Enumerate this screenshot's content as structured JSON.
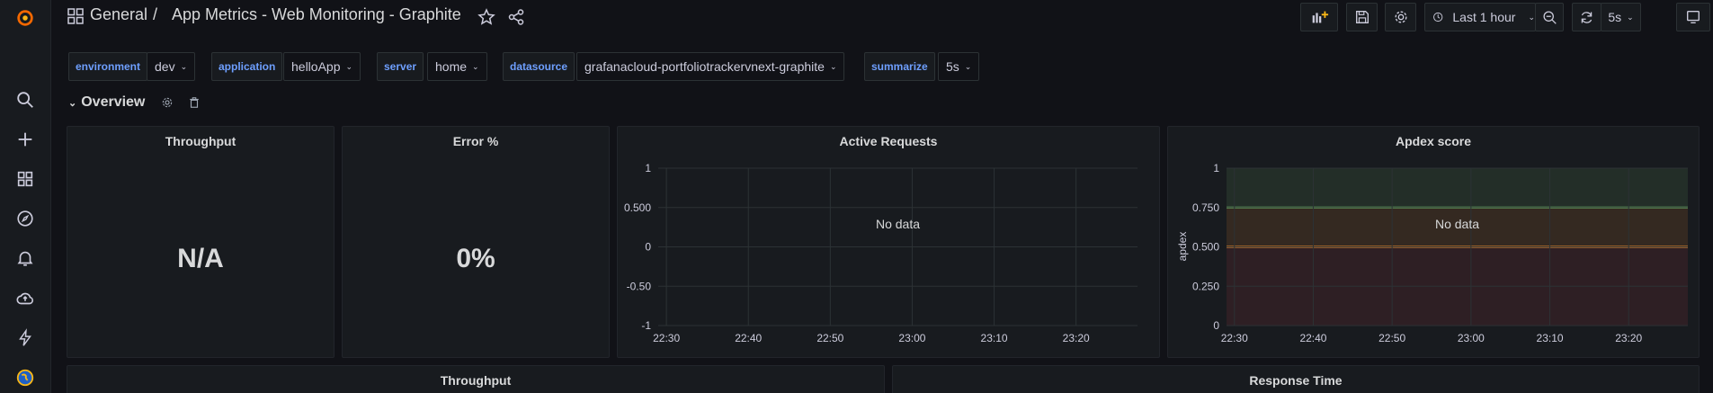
{
  "breadcrumb": {
    "folder": "General",
    "separator": "/",
    "title": "App Metrics - Web Monitoring - Graphite"
  },
  "toolbar": {
    "time_range": "Last 1 hour",
    "refresh": "5s"
  },
  "variables": [
    {
      "label": "environment",
      "value": "dev"
    },
    {
      "label": "application",
      "value": "helloApp"
    },
    {
      "label": "server",
      "value": "home"
    },
    {
      "label": "datasource",
      "value": "grafanacloud-portfoliotrackervnext-graphite"
    },
    {
      "label": "summarize",
      "value": "5s"
    }
  ],
  "row": {
    "title": "Overview"
  },
  "panels": {
    "throughput": {
      "title": "Throughput",
      "value": "N/A"
    },
    "error": {
      "title": "Error %",
      "value": "0%"
    },
    "active_requests": {
      "title": "Active Requests",
      "no_data": "No data"
    },
    "apdex": {
      "title": "Apdex score",
      "no_data": "No data",
      "ylabel": "apdex"
    },
    "throughput2": {
      "title": "Throughput"
    },
    "response_time": {
      "title": "Response Time"
    }
  },
  "chart_data": [
    {
      "type": "line",
      "title": "Active Requests",
      "x_ticks": [
        "22:30",
        "22:40",
        "22:50",
        "23:00",
        "23:10",
        "23:20"
      ],
      "y_ticks": [
        "1",
        "0.500",
        "0",
        "-0.50",
        "-1"
      ],
      "ylim": [
        -1,
        1
      ],
      "series": [],
      "grid": true
    },
    {
      "type": "line",
      "title": "Apdex score",
      "ylabel": "apdex",
      "x_ticks": [
        "22:30",
        "22:40",
        "22:50",
        "23:00",
        "23:10",
        "23:20"
      ],
      "y_ticks": [
        "1",
        "0.750",
        "0.500",
        "0.250",
        "0"
      ],
      "ylim": [
        0,
        1
      ],
      "thresholds": [
        {
          "value": 0.75,
          "color": "#73bf69"
        },
        {
          "value": 0.5,
          "color": "#ff9830"
        }
      ],
      "series": [],
      "grid": true
    }
  ],
  "colors": {
    "accent": "#6e9fff",
    "ok": "#73bf69",
    "warn": "#ff9830",
    "bad": "#f2495c"
  }
}
